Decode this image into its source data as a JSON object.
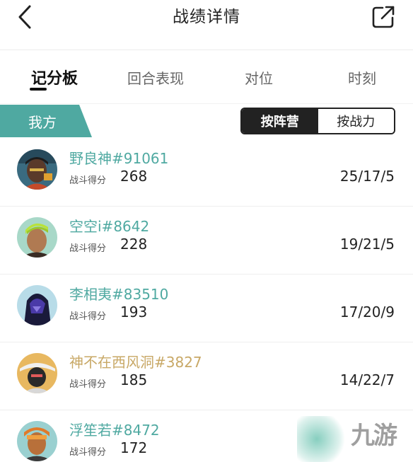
{
  "header": {
    "title": "战绩详情"
  },
  "tabs": [
    {
      "label": "记分板"
    },
    {
      "label": "回合表现"
    },
    {
      "label": "对位"
    },
    {
      "label": "时刻"
    }
  ],
  "team": {
    "label": "我方"
  },
  "toggle": {
    "by_camp": "按阵营",
    "by_power": "按战力"
  },
  "players": [
    {
      "name": "野良神#91061",
      "score_label": "战斗得分",
      "score": "268",
      "kda": "25/17/5"
    },
    {
      "name": "空空i#8642",
      "score_label": "战斗得分",
      "score": "228",
      "kda": "19/21/5"
    },
    {
      "name": "李相夷#83510",
      "score_label": "战斗得分",
      "score": "193",
      "kda": "17/20/9"
    },
    {
      "name": "神不在西风洞#3827",
      "score_label": "战斗得分",
      "score": "185",
      "kda": "14/22/7"
    },
    {
      "name": "浮笙若#8472",
      "score_label": "战斗得分",
      "score": "172",
      "kda": ""
    }
  ],
  "watermark": {
    "text": "九游"
  },
  "colors": {
    "accent": "#4fa9a1",
    "gold_name": "#c8a866",
    "active_toggle": "#222222"
  }
}
